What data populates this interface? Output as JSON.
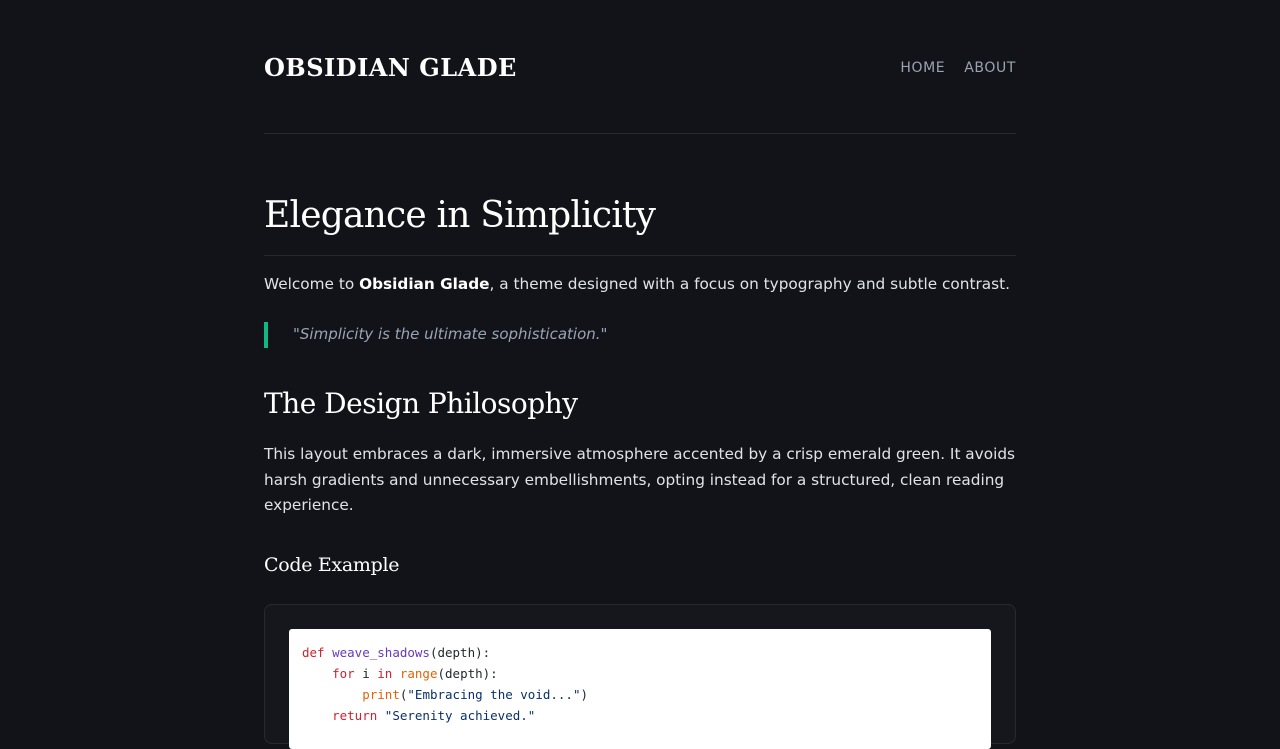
{
  "site": {
    "title": "OBSIDIAN GLADE"
  },
  "nav": {
    "items": [
      {
        "label": "HOME"
      },
      {
        "label": "ABOUT"
      }
    ]
  },
  "article": {
    "title": "Elegance in Simplicity",
    "intro": {
      "before": "Welcome to ",
      "bold": "Obsidian Glade",
      "after": ", a theme designed with a focus on typography and subtle contrast."
    },
    "quote": "\"Simplicity is the ultimate sophistication.\"",
    "section_heading": "The Design Philosophy",
    "section_paragraph": "This layout embraces a dark, immersive atmosphere accented by a crisp emerald green. It avoids harsh gradients and unnecessary embellishments, opting instead for a structured, clean reading experience.",
    "code_heading": "Code Example",
    "code": {
      "line1": {
        "kw": "def",
        "fn": "weave_shadows",
        "rest": "(depth):"
      },
      "line2": {
        "indent": "    ",
        "kw1": "for",
        "var": " i ",
        "kw2": "in",
        "sp": " ",
        "bi": "range",
        "rest": "(depth):"
      },
      "line3": {
        "indent": "        ",
        "bi": "print",
        "open": "(",
        "str": "\"Embracing the void...\"",
        "close": ")"
      },
      "line4": {
        "indent": "    ",
        "kw": "return",
        "sp": " ",
        "str": "\"Serenity achieved.\""
      }
    }
  },
  "colors": {
    "background": "#111318",
    "accent": "#10b981",
    "text": "#e3e5ea",
    "muted": "#9aa3b4"
  }
}
